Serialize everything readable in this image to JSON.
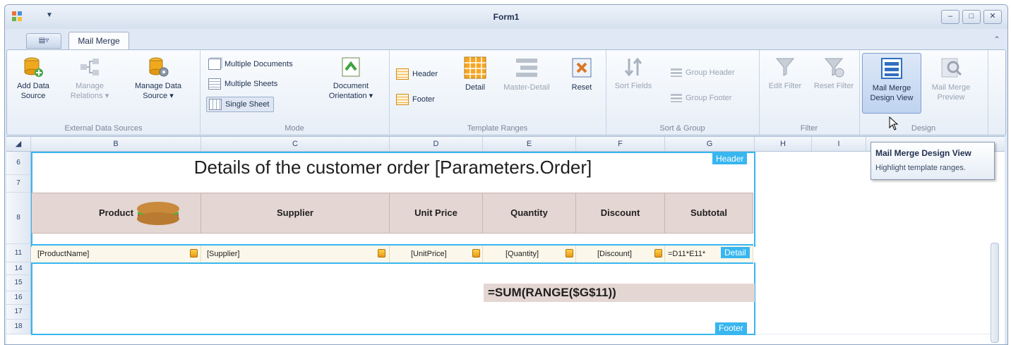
{
  "window": {
    "title": "Form1"
  },
  "tabs": {
    "file_tab": "",
    "active_tab": "Mail Merge"
  },
  "ribbon": {
    "groups": [
      {
        "label": "External Data Sources",
        "buttons": [
          "Add Data Source",
          "Manage Relations",
          "Manage Data Source"
        ]
      },
      {
        "label": "Mode",
        "options": [
          "Multiple Documents",
          "Multiple Sheets",
          "Single Sheet"
        ],
        "selected": "Single Sheet",
        "orientation": "Document Orientation"
      },
      {
        "label": "Template Ranges",
        "buttons": [
          "Header",
          "Footer",
          "Detail",
          "Master-Detail",
          "Reset"
        ]
      },
      {
        "label": "Sort & Group",
        "buttons": [
          "Sort Fields",
          "Group Header",
          "Group Footer"
        ]
      },
      {
        "label": "Filter",
        "buttons": [
          "Edit Filter",
          "Reset Filter"
        ]
      },
      {
        "label": "Design",
        "buttons": [
          "Mail Merge Design View",
          "Mail Merge Preview"
        ],
        "active": "Mail Merge Design View"
      }
    ]
  },
  "tooltip": {
    "title": "Mail Merge Design View",
    "body": "Highlight template ranges."
  },
  "sheet": {
    "columns": [
      "B",
      "C",
      "D",
      "E",
      "F",
      "G",
      "H",
      "I"
    ],
    "rows": [
      "6",
      "7",
      "8",
      "11",
      "14",
      "15",
      "16",
      "17",
      "18"
    ],
    "title": "Details of the customer order [Parameters.Order]",
    "headers": [
      "Product",
      "Supplier",
      "Unit Price",
      "Quantity",
      "Discount",
      "Subtotal"
    ],
    "detail": [
      "[ProductName]",
      "[Supplier]",
      "[UnitPrice]",
      "[Quantity]",
      "[Discount]",
      "=D11*E11*"
    ],
    "sum_formula": "=SUM(RANGE($G$11))",
    "range_tags": {
      "header": "Header",
      "detail": "Detail",
      "footer": "Footer"
    }
  }
}
